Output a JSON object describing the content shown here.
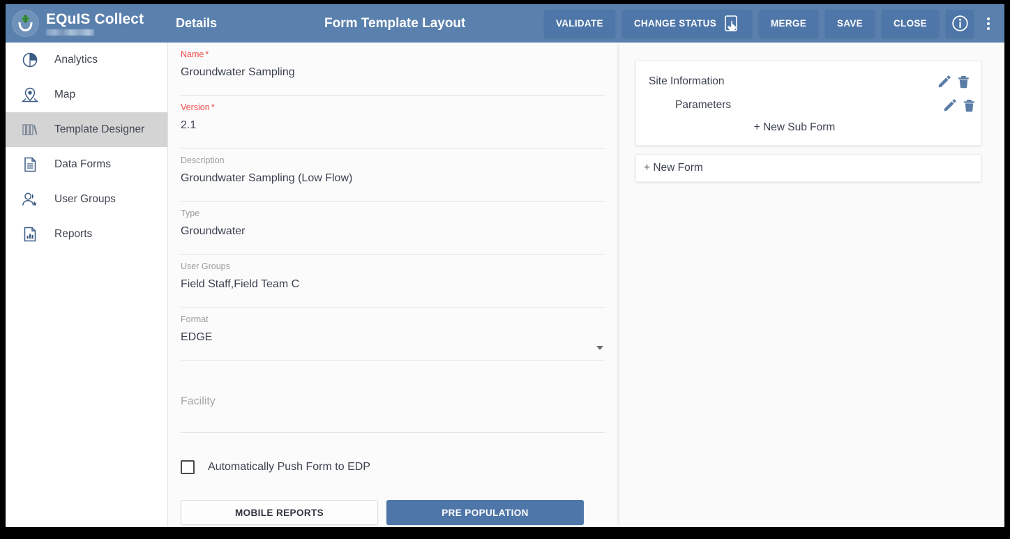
{
  "header": {
    "brand": "EQuIS Collect",
    "brand_sub_redacted": "",
    "section": "Details",
    "title": "Form Template Layout",
    "buttons": [
      {
        "label": "VALIDATE",
        "name": "validate-button"
      },
      {
        "label": "CHANGE STATUS",
        "name": "change-status-button",
        "icon": "tap-device-icon"
      },
      {
        "label": "MERGE",
        "name": "merge-button"
      },
      {
        "label": "SAVE",
        "name": "save-button"
      },
      {
        "label": "CLOSE",
        "name": "close-button"
      }
    ],
    "info_icon": "info-icon",
    "overflow_icon": "kebab-menu-icon",
    "colors": {
      "bar": "#5a80ad",
      "button": "#4f76a8"
    }
  },
  "sidebar": {
    "items": [
      {
        "label": "Analytics",
        "icon": "pie-chart-icon",
        "active": false
      },
      {
        "label": "Map",
        "icon": "map-pin-icon",
        "active": false
      },
      {
        "label": "Template Designer",
        "icon": "books-icon",
        "active": true
      },
      {
        "label": "Data Forms",
        "icon": "document-icon",
        "active": false
      },
      {
        "label": "User Groups",
        "icon": "users-icon",
        "active": false
      },
      {
        "label": "Reports",
        "icon": "bar-chart-document-icon",
        "active": false
      }
    ],
    "active_bg": "#d4d4d4"
  },
  "form": {
    "fields": [
      {
        "label": "Name",
        "required": true,
        "value": "Groundwater Sampling",
        "placeholder": "",
        "type": "text",
        "name": "name-field"
      },
      {
        "label": "Version",
        "required": true,
        "value": "2.1",
        "placeholder": "",
        "type": "text",
        "name": "version-field"
      },
      {
        "label": "Description",
        "required": false,
        "value": "Groundwater Sampling (Low Flow)",
        "placeholder": "",
        "type": "text",
        "name": "description-field"
      },
      {
        "label": "Type",
        "required": false,
        "value": "Groundwater",
        "placeholder": "",
        "type": "text",
        "name": "type-field"
      },
      {
        "label": "User Groups",
        "required": false,
        "value": "Field Staff,Field Team C",
        "placeholder": "",
        "type": "text",
        "name": "user-groups-field"
      },
      {
        "label": "Format",
        "required": false,
        "value": "EDGE",
        "placeholder": "",
        "type": "select",
        "name": "format-select"
      },
      {
        "label": "",
        "required": false,
        "value": "",
        "placeholder": "Facility",
        "type": "text",
        "name": "facility-field"
      }
    ],
    "checkbox": {
      "label": "Automatically Push Form to EDP",
      "checked": false
    },
    "buttons": {
      "mobile_reports": "MOBILE REPORTS",
      "pre_population": "PRE POPULATION"
    },
    "required_color": "#f04a4a"
  },
  "tree": {
    "forms": [
      {
        "label": "Site Information",
        "edit_icon": "pencil-icon",
        "delete_icon": "trash-icon",
        "subforms": [
          {
            "label": "Parameters",
            "edit_icon": "pencil-icon",
            "delete_icon": "trash-icon"
          }
        ],
        "add_subform_label": "+ New Sub Form"
      }
    ],
    "add_form_label": "+ New Form"
  }
}
